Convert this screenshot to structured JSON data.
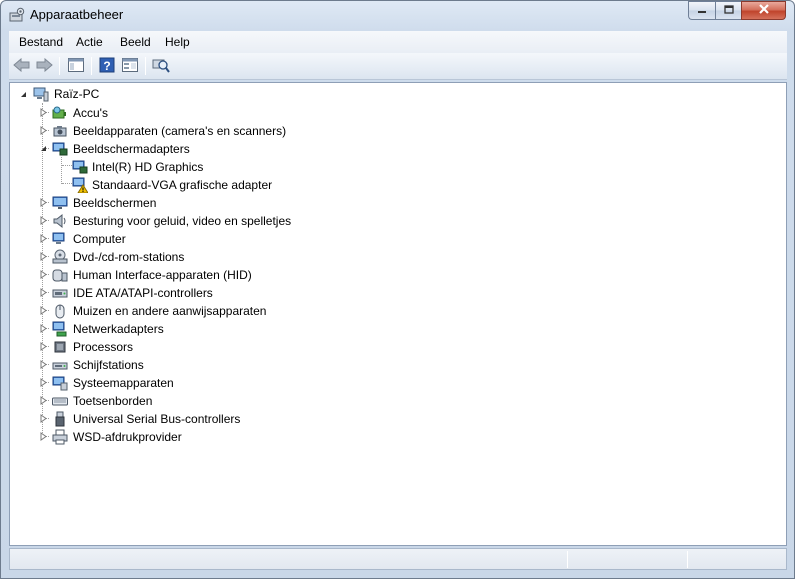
{
  "window": {
    "title": "Apparaatbeheer",
    "app_icon": "device-manager-icon"
  },
  "menu": [
    "Bestand",
    "Actie",
    "Beeld",
    "Help"
  ],
  "toolbar": {
    "buttons": [
      "back-arrow-icon",
      "forward-arrow-icon",
      "show-hide-console-tree-icon",
      "help-icon",
      "properties-icon",
      "scan-hardware-icon"
    ]
  },
  "tree": {
    "root": {
      "label": "Raïz-PC",
      "icon": "computer-icon",
      "expanded": true
    },
    "categories": [
      {
        "label": "Accu's",
        "icon": "battery-icon",
        "expanded": false,
        "children": []
      },
      {
        "label": "Beeldapparaten (camera's en scanners)",
        "icon": "camera-icon",
        "expanded": false,
        "children": []
      },
      {
        "label": "Beeldschermadapters",
        "icon": "display-adapter-icon",
        "expanded": true,
        "children": [
          {
            "label": "Intel(R) HD Graphics",
            "icon": "display-adapter-icon",
            "warning": false
          },
          {
            "label": "Standaard-VGA grafische adapter",
            "icon": "display-adapter-warning-icon",
            "warning": true
          }
        ]
      },
      {
        "label": "Beeldschermen",
        "icon": "monitor-icon",
        "expanded": false,
        "children": []
      },
      {
        "label": "Besturing voor geluid, video en spelletjes",
        "icon": "speaker-icon",
        "expanded": false,
        "children": []
      },
      {
        "label": "Computer",
        "icon": "computer-icon",
        "expanded": false,
        "children": []
      },
      {
        "label": "Dvd-/cd-rom-stations",
        "icon": "optical-drive-icon",
        "expanded": false,
        "children": []
      },
      {
        "label": "Human Interface-apparaten (HID)",
        "icon": "hid-icon",
        "expanded": false,
        "children": []
      },
      {
        "label": "IDE ATA/ATAPI-controllers",
        "icon": "ide-controller-icon",
        "expanded": false,
        "children": []
      },
      {
        "label": "Muizen en andere aanwijsapparaten",
        "icon": "mouse-icon",
        "expanded": false,
        "children": []
      },
      {
        "label": "Netwerkadapters",
        "icon": "network-adapter-icon",
        "expanded": false,
        "children": []
      },
      {
        "label": "Processors",
        "icon": "processor-icon",
        "expanded": false,
        "children": []
      },
      {
        "label": "Schijfstations",
        "icon": "disk-drive-icon",
        "expanded": false,
        "children": []
      },
      {
        "label": "Systeemapparaten",
        "icon": "system-device-icon",
        "expanded": false,
        "children": []
      },
      {
        "label": "Toetsenborden",
        "icon": "keyboard-icon",
        "expanded": false,
        "children": []
      },
      {
        "label": "Universal Serial Bus-controllers",
        "icon": "usb-icon",
        "expanded": false,
        "children": []
      },
      {
        "label": "WSD-afdrukprovider",
        "icon": "printer-icon",
        "expanded": false,
        "children": []
      }
    ]
  },
  "colors": {
    "title_bg": "#cfdcec",
    "close_button": "#c7462f",
    "warning": "#f2c200"
  }
}
